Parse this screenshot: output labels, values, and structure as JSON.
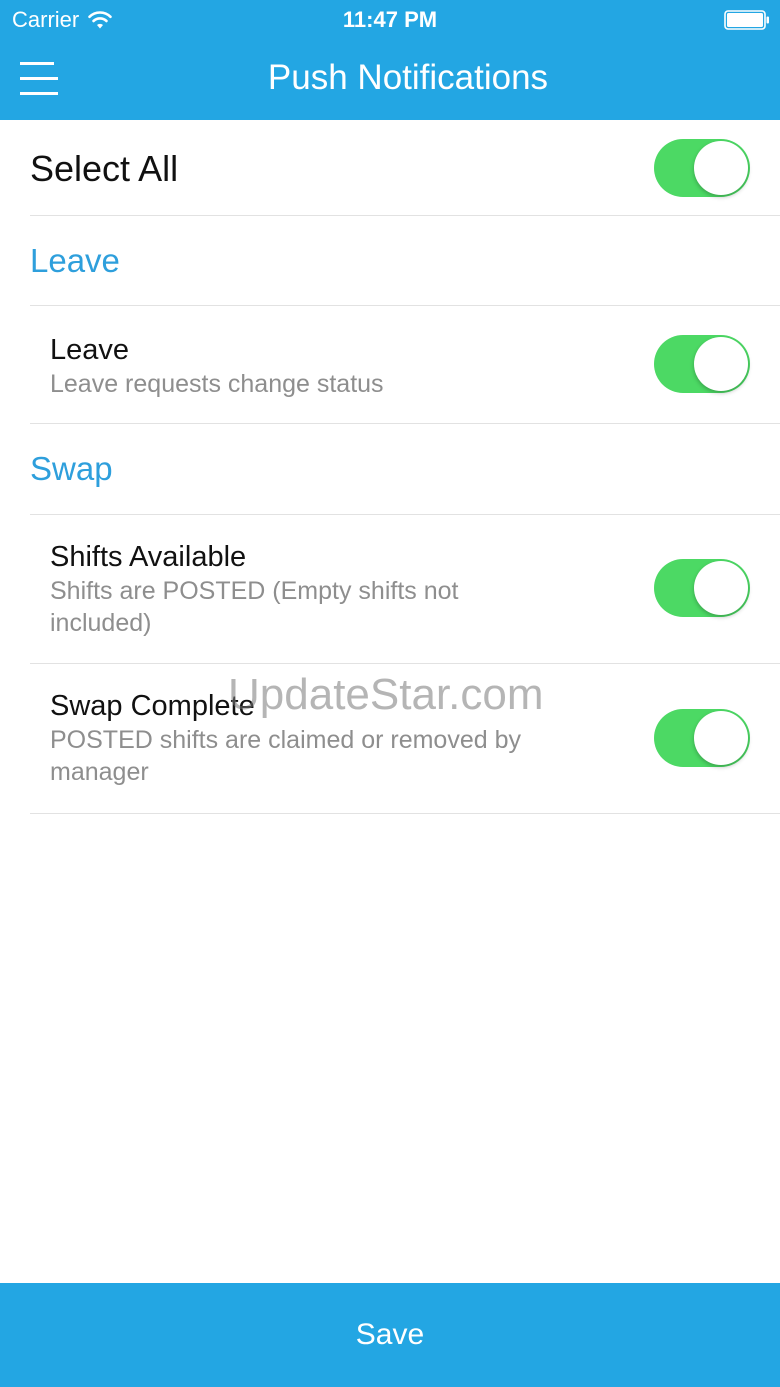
{
  "status_bar": {
    "carrier": "Carrier",
    "time": "11:47 PM"
  },
  "nav": {
    "title": "Push Notifications",
    "menu_icon": "hamburger-menu-icon"
  },
  "select_all": {
    "label": "Select All",
    "enabled": true
  },
  "sections": [
    {
      "title": "Leave",
      "items": [
        {
          "title": "Leave",
          "subtitle": "Leave requests change status",
          "enabled": true
        }
      ]
    },
    {
      "title": "Swap",
      "items": [
        {
          "title": "Shifts Available",
          "subtitle": "Shifts are POSTED (Empty shifts not included)",
          "enabled": true
        },
        {
          "title": "Swap Complete",
          "subtitle": "POSTED shifts are claimed or removed by manager",
          "enabled": true
        }
      ]
    }
  ],
  "watermark": "UpdateStar.com",
  "footer": {
    "save_label": "Save"
  },
  "colors": {
    "primary": "#23a6e3",
    "section_title": "#2e9fdc",
    "toggle_on": "#4cd964",
    "subtitle": "#8e8e8e"
  }
}
